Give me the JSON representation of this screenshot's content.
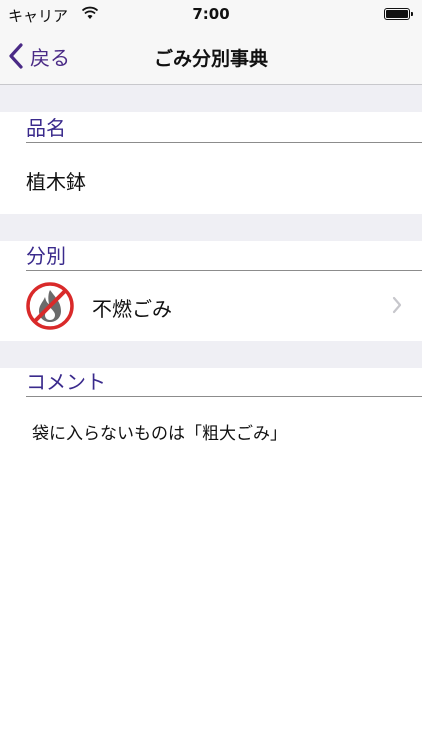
{
  "status_bar": {
    "carrier": "キャリア",
    "time": "7:00"
  },
  "nav": {
    "back_label": "戻る",
    "title": "ごみ分別事典"
  },
  "sections": {
    "item": {
      "header": "品名",
      "value": "植木鉢"
    },
    "category": {
      "header": "分別",
      "label": "不燃ごみ",
      "icon": "no-burn-icon"
    },
    "comment": {
      "header": "コメント",
      "text": "袋に入らないものは「粗大ごみ」"
    }
  },
  "colors": {
    "accent": "#4a2a86",
    "header_text": "#3a2a8c",
    "gap_bg": "#efeff4",
    "prohibit_red": "#d92a2a"
  }
}
